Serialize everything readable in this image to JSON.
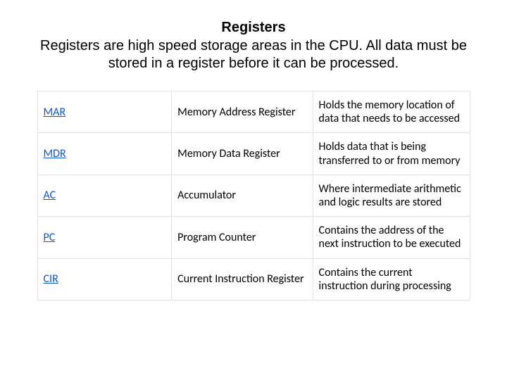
{
  "heading": {
    "title": "Registers",
    "subtitle_line1": "Registers are high speed storage areas in the CPU.  All data must be",
    "subtitle_line2": "stored in a register before it can be processed."
  },
  "registers": [
    {
      "abbr": "MAR",
      "name": "Memory Address Register",
      "desc": "Holds the memory location of data that needs to be accessed"
    },
    {
      "abbr": "MDR",
      "name": "Memory Data Register",
      "desc": "Holds data that is being transferred to or from memory"
    },
    {
      "abbr": "AC",
      "name": "Accumulator",
      "desc": "Where intermediate arithmetic and logic results are stored"
    },
    {
      "abbr": "PC",
      "name": "Program Counter",
      "desc": "Contains the address of the next instruction to be executed"
    },
    {
      "abbr": "CIR",
      "name": "Current Instruction Register",
      "desc": "Contains the current instruction during processing"
    }
  ]
}
